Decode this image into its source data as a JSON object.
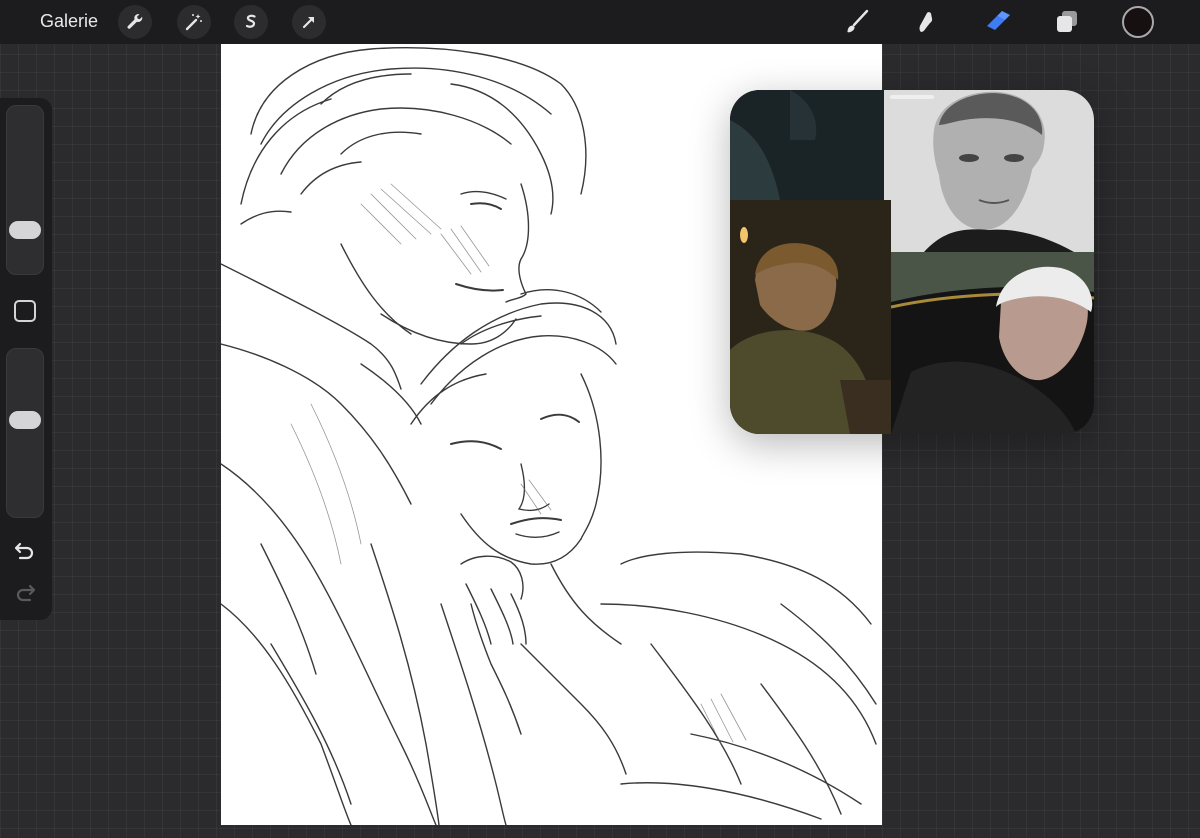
{
  "toolbar": {
    "gallery_label": "Galerie",
    "left_tools": [
      "wrench-icon",
      "magic-wand-icon",
      "selection-icon",
      "transform-arrow-icon"
    ],
    "right_tools": [
      "brush-icon",
      "smudge-icon",
      "eraser-icon",
      "layers-icon"
    ],
    "active_tool": "eraser-icon",
    "current_color": "#171010",
    "active_color": "#3d7cf5"
  },
  "sidebar": {
    "brush_size_level": 0.22,
    "opacity_level": 0.58,
    "controls": [
      "brush-size-slider",
      "modifier-button",
      "opacity-slider",
      "undo-icon",
      "redo-icon"
    ]
  },
  "canvas": {
    "content": "pencil-sketch"
  },
  "reference": {
    "photos": [
      "photo-dark-scene",
      "photo-bw-portrait",
      "photo-candlelit-man",
      "photo-white-haired-man"
    ]
  }
}
